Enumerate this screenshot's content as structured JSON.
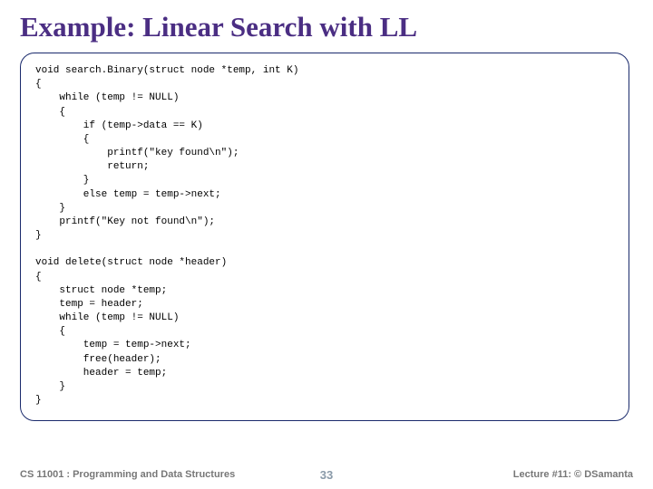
{
  "title": "Example: Linear Search with LL",
  "code": "void search.Binary(struct node *temp, int K)\n{\n    while (temp != NULL)\n    {\n        if (temp->data == K)\n        {\n            printf(\"key found\\n\");\n            return;\n        }\n        else temp = temp->next;\n    }\n    printf(\"Key not found\\n\");\n}\n\nvoid delete(struct node *header)\n{\n    struct node *temp;\n    temp = header;\n    while (temp != NULL)\n    {\n        temp = temp->next;\n        free(header);\n        header = temp;\n    }\n}",
  "footer": {
    "left": "CS 11001 : Programming and Data Structures",
    "center": "33",
    "right": "Lecture #11: © DSamanta"
  }
}
